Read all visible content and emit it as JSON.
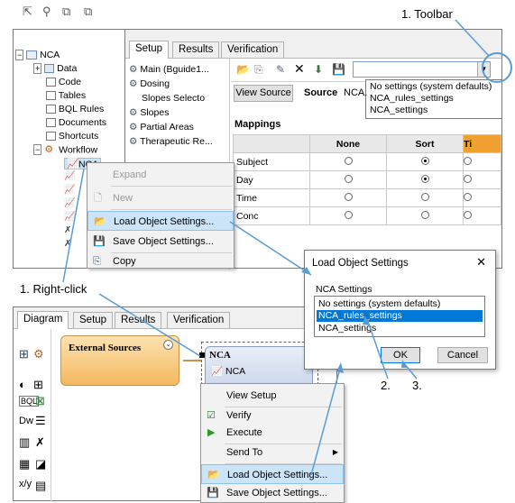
{
  "annotations": {
    "toolbar": "1. Toolbar",
    "right_click": "1. Right-click",
    "step2": "2.",
    "step3": "3."
  },
  "top_tree": {
    "root": "NCA",
    "items": [
      "Data",
      "Code",
      "Tables",
      "BQL Rules",
      "Documents",
      "Shortcuts",
      "Workflow"
    ],
    "selected": "NCA"
  },
  "top_tabs": [
    "Setup",
    "Results",
    "Verification"
  ],
  "setup_list": [
    "Main (Bguide1...",
    "Dosing",
    "Slopes Selecto",
    "Slopes",
    "Partial Areas",
    "Therapeutic Re..."
  ],
  "toolbar": {
    "view_source": "View Source",
    "source_label": "Source",
    "source_value": "NCA.",
    "dropdown_options": [
      "No settings (system defaults)",
      "NCA_rules_settings",
      "NCA_settings"
    ]
  },
  "mappings": {
    "title": "Mappings",
    "columns": [
      "None",
      "Sort",
      "Ti"
    ],
    "rows": [
      {
        "label": "Subject",
        "sort": true
      },
      {
        "label": "Day",
        "sort": true
      },
      {
        "label": "Time",
        "sort": false
      },
      {
        "label": "Conc",
        "sort": false
      }
    ]
  },
  "context_menu_top": {
    "items": [
      "Expand",
      "New",
      "Load Object Settings...",
      "Save Object Settings...",
      "Copy"
    ]
  },
  "dialog": {
    "title": "Load Object Settings",
    "close": "✕",
    "group_label": "NCA Settings",
    "options": [
      "No settings (system defaults)",
      "NCA_rules_settings",
      "NCA_settings"
    ],
    "selected_index": 1,
    "ok": "OK",
    "cancel": "Cancel"
  },
  "bottom_tabs": [
    "Diagram",
    "Setup",
    "Results",
    "Verification"
  ],
  "diagram": {
    "external_sources": "External Sources",
    "nca_title": "NCA",
    "nca_item": "NCA"
  },
  "context_menu_bottom": {
    "items": [
      "View Setup",
      "Verify",
      "Execute",
      "Send To",
      "Load Object Settings...",
      "Save Object Settings..."
    ]
  },
  "colors": {
    "highlight": "#cce4f7",
    "selection": "#0078d7",
    "callout": "#5b9bd5",
    "orange": "#f0a030"
  }
}
